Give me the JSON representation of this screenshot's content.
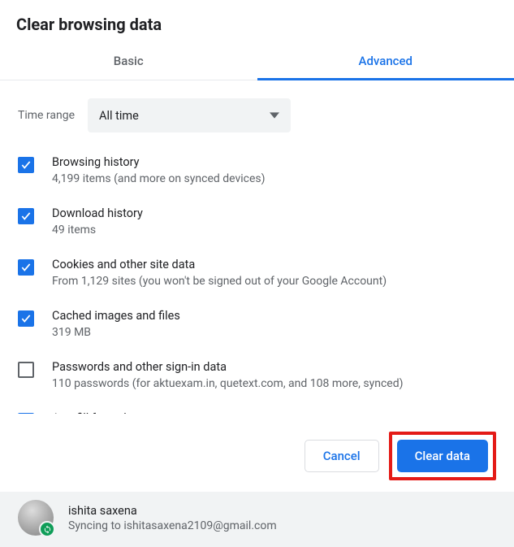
{
  "dialog": {
    "title": "Clear browsing data"
  },
  "tabs": {
    "basic": "Basic",
    "advanced": "Advanced",
    "activeIndex": 1
  },
  "timeRange": {
    "label": "Time range",
    "value": "All time"
  },
  "items": [
    {
      "key": "browsing-history",
      "checked": true,
      "title": "Browsing history",
      "desc": "4,199 items (and more on synced devices)"
    },
    {
      "key": "download-history",
      "checked": true,
      "title": "Download history",
      "desc": "49 items"
    },
    {
      "key": "cookies",
      "checked": true,
      "title": "Cookies and other site data",
      "desc": "From 1,129 sites (you won't be signed out of your Google Account)"
    },
    {
      "key": "cache",
      "checked": true,
      "title": "Cached images and files",
      "desc": "319 MB"
    },
    {
      "key": "passwords",
      "checked": false,
      "title": "Passwords and other sign-in data",
      "desc": "110 passwords (for aktuexam.in, quetext.com, and 108 more, synced)"
    },
    {
      "key": "autofill",
      "checked": true,
      "title": "Autofill form data",
      "desc": ""
    }
  ],
  "buttons": {
    "cancel": "Cancel",
    "clear": "Clear data"
  },
  "user": {
    "name": "ishita saxena",
    "status": "Syncing to ishitasaxena2109@gmail.com"
  }
}
